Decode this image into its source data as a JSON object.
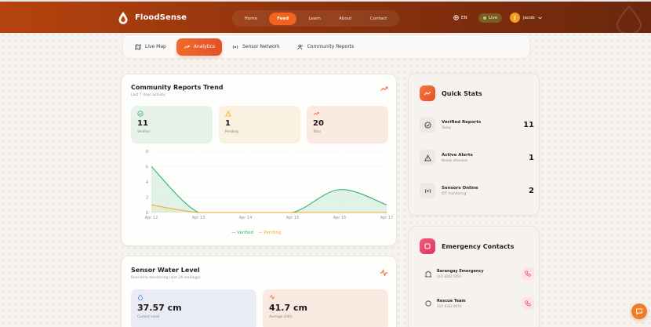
{
  "brand": {
    "name": "FloodSense"
  },
  "nav": {
    "items": [
      "Home",
      "Feed",
      "Learn",
      "About",
      "Contact"
    ],
    "active_index": 1
  },
  "header": {
    "lang": "EN",
    "live": "Live",
    "user": "jacob",
    "avatar_initial": "J"
  },
  "tabs": [
    {
      "label": "Live Map",
      "icon": "map-icon"
    },
    {
      "label": "Analytics",
      "icon": "trending-icon",
      "active": true
    },
    {
      "label": "Sensor Network",
      "icon": "sensor-icon"
    },
    {
      "label": "Community Reports",
      "icon": "users-icon"
    }
  ],
  "trend": {
    "title": "Community Reports Trend",
    "subtitle": "Last 7 days activity",
    "stats": [
      {
        "value": "11",
        "label": "Verified",
        "icon": "check-circle-icon",
        "color": "#2fae74"
      },
      {
        "value": "1",
        "label": "Pending",
        "icon": "warning-icon",
        "color": "#f2a826"
      },
      {
        "value": "20",
        "label": "Total",
        "icon": "trending-icon",
        "color": "#ef6a2b"
      }
    ]
  },
  "chart_data": {
    "type": "area",
    "categories": [
      "Apr 12",
      "Apr 13",
      "Apr 14",
      "Apr 15",
      "Apr 16",
      "Apr 17"
    ],
    "x_tick_labels": [
      "Apr 12",
      "Apr 13",
      "Apr 14",
      "Apr 15",
      "Apr 16",
      "Apr 17"
    ],
    "ylim": [
      0,
      8
    ],
    "yticks": [
      "8",
      "6",
      "4",
      "2",
      "0"
    ],
    "series": [
      {
        "name": "Verified",
        "color": "#2fae74",
        "values": [
          6,
          0,
          0,
          0,
          3,
          1
        ]
      },
      {
        "name": "Pending",
        "color": "#f2a826",
        "values": [
          1,
          0,
          0,
          0,
          0,
          0
        ]
      }
    ],
    "legend_position": "bottom-center",
    "grid": true
  },
  "sensor": {
    "title": "Sensor Water Level",
    "subtitle": "Real-time monitoring (last 24 readings)",
    "levels": [
      {
        "value": "37.57 cm",
        "label": "Current Level",
        "icon": "droplet-icon"
      },
      {
        "value": "41.7 cm",
        "label": "Average (24h)",
        "icon": "activity-icon"
      }
    ]
  },
  "quick_stats": {
    "title": "Quick Stats",
    "rows": [
      {
        "label": "Verified Reports",
        "sub": "Today",
        "value": "11",
        "icon": "check-circle-icon"
      },
      {
        "label": "Active Alerts",
        "sub": "Needs attention",
        "value": "1",
        "icon": "warning-icon"
      },
      {
        "label": "Sensors Online",
        "sub": "IOT monitoring",
        "value": "2",
        "icon": "sensor-icon"
      }
    ]
  },
  "emergency": {
    "title": "Emergency Contacts",
    "contacts": [
      {
        "name": "Barangay Emergency",
        "number": "(02) 8362 0054",
        "icon": "building-icon"
      },
      {
        "name": "Rescue Team",
        "number": "(02) 8362 0070",
        "icon": "person-icon"
      }
    ]
  },
  "colors": {
    "accent": "#ef6a2b",
    "header_start": "#b6430f",
    "header_end": "#6a270d",
    "verified": "#2fae74",
    "pending": "#f2a826",
    "emergency": "#e0345e"
  }
}
